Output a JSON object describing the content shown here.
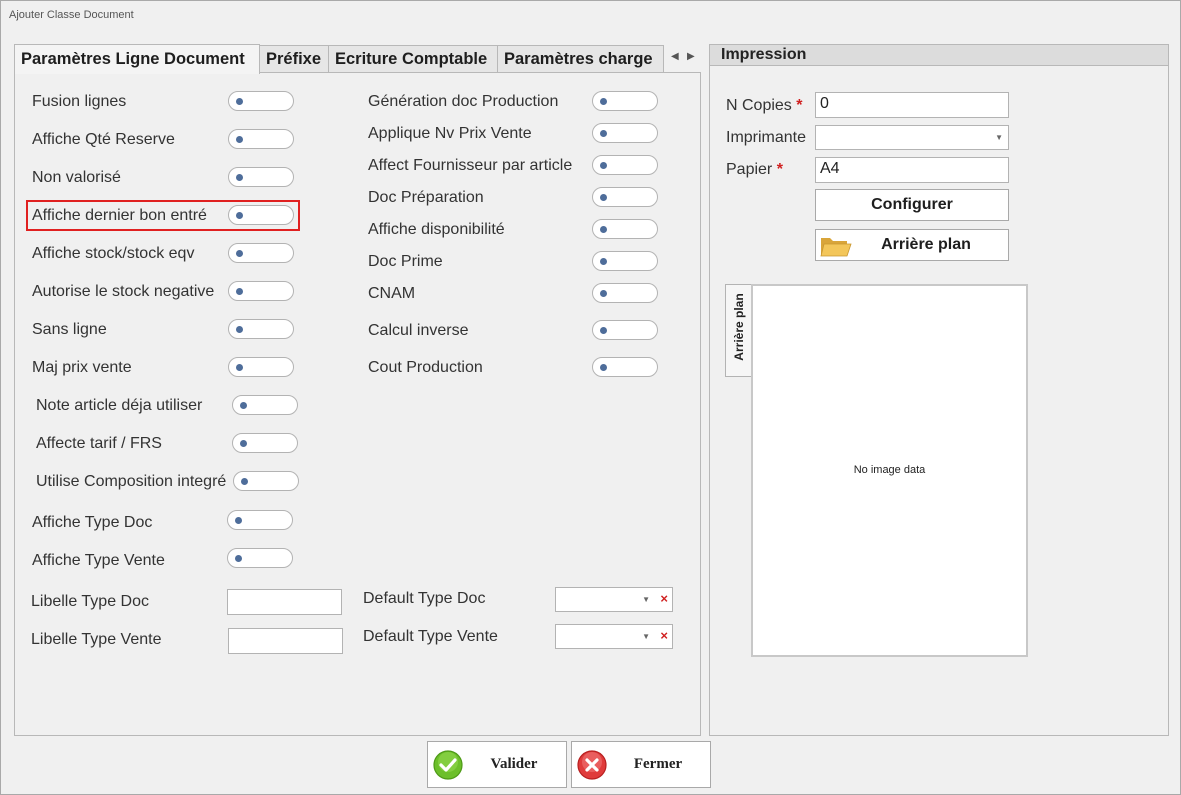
{
  "window": {
    "title": "Ajouter Classe Document"
  },
  "tabs": [
    {
      "label": "Paramètres Ligne Document"
    },
    {
      "label": "Préfixe"
    },
    {
      "label": "Ecriture Comptable"
    },
    {
      "label": "Paramètres charge"
    }
  ],
  "left_options": [
    {
      "label": "Fusion lignes",
      "checked": false
    },
    {
      "label": "Affiche Qté Reserve",
      "checked": false
    },
    {
      "label": "Non valorisé",
      "checked": false
    },
    {
      "label": "Affiche dernier bon entré",
      "checked": false
    },
    {
      "label": "Affiche stock/stock eqv",
      "checked": false
    },
    {
      "label": "Autorise le stock negative",
      "checked": false
    },
    {
      "label": "Sans ligne",
      "checked": false
    },
    {
      "label": "Maj prix vente",
      "checked": false
    },
    {
      "label": "Note article déja utiliser",
      "checked": false
    },
    {
      "label": "Affecte tarif / FRS",
      "checked": false
    },
    {
      "label": "Utilise Composition integré",
      "checked": false
    },
    {
      "label": "Affiche Type Doc",
      "checked": false
    },
    {
      "label": "Affiche Type Vente",
      "checked": false
    }
  ],
  "right_options": [
    {
      "label": "Génération doc Production",
      "checked": false
    },
    {
      "label": "Applique Nv Prix Vente",
      "checked": false
    },
    {
      "label": "Affect Fournisseur par article",
      "checked": false
    },
    {
      "label": "Doc Préparation",
      "checked": false
    },
    {
      "label": "Affiche disponibilité",
      "checked": false
    },
    {
      "label": "Doc Prime",
      "checked": false
    },
    {
      "label": "CNAM",
      "checked": false
    },
    {
      "label": "Calcul inverse",
      "checked": false
    },
    {
      "label": "Cout Production",
      "checked": false
    }
  ],
  "fields": {
    "libelle_type_doc": {
      "label": "Libelle Type Doc",
      "value": ""
    },
    "libelle_type_vente": {
      "label": "Libelle Type Vente",
      "value": ""
    },
    "default_type_doc": {
      "label": "Default Type Doc",
      "value": ""
    },
    "default_type_vente": {
      "label": "Default Type Vente",
      "value": ""
    }
  },
  "impression": {
    "title": "Impression",
    "n_copies": {
      "label": "N Copies",
      "required": "*",
      "value": "0"
    },
    "imprimante": {
      "label": "Imprimante",
      "value": ""
    },
    "papier": {
      "label": "Papier",
      "required": "*",
      "value": "A4"
    },
    "configurer_label": "Configurer",
    "arriere_plan_label": "Arrière plan",
    "preview_tab_label": "Arrière plan",
    "preview_placeholder": "No image data"
  },
  "buttons": {
    "valider": "Valider",
    "fermer": "Fermer"
  },
  "colors": {
    "highlight": "#e02020",
    "toggle_knob": "#4e6d9a",
    "required": "#d02020",
    "valider_icon": "#6cbf2a",
    "fermer_icon": "#e03b3b"
  }
}
